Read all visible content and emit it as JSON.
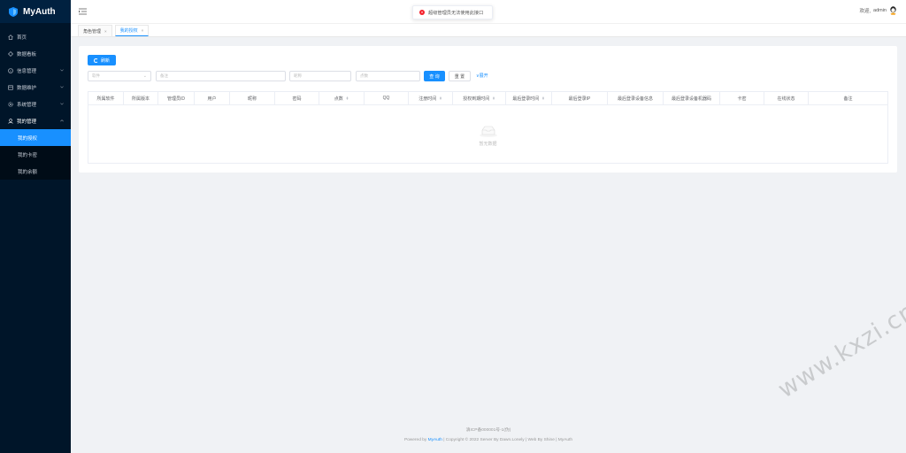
{
  "app": {
    "title": "MyAuth"
  },
  "sidebar": {
    "items": [
      {
        "label": "首页",
        "icon": "home-icon"
      },
      {
        "label": "数据看板",
        "icon": "dashboard-icon"
      },
      {
        "label": "信息管理",
        "icon": "info-icon"
      },
      {
        "label": "数据维护",
        "icon": "database-icon"
      },
      {
        "label": "系统管理",
        "icon": "gear-icon"
      },
      {
        "label": "我的管理",
        "icon": "user-icon"
      }
    ],
    "submenu": [
      {
        "label": "我的授权",
        "active": true
      },
      {
        "label": "我的卡密",
        "active": false
      },
      {
        "label": "我的余额",
        "active": false
      }
    ]
  },
  "header": {
    "welcome": "欢迎,",
    "user": "admin"
  },
  "toast": {
    "message": "超级管理员无法使用此接口"
  },
  "tabs": [
    {
      "label": "角色管理",
      "close": "×"
    },
    {
      "label": "我的授权",
      "close": "×"
    }
  ],
  "toolbar": {
    "refresh_label": "刷新"
  },
  "filters": {
    "software_placeholder": "软件",
    "remark_placeholder": "备注",
    "nickname_placeholder": "昵称",
    "points_placeholder": "点数",
    "search_label": "查 询",
    "reset_label": "重 置",
    "expand_label": "展开"
  },
  "table": {
    "columns": [
      "所属软件",
      "所属版本",
      "管理员ID",
      "用户",
      "昵称",
      "密码",
      "点数",
      "QQ",
      "注册时间",
      "授权到期时间",
      "最后登录时间",
      "最后登录IP",
      "最后登录设备信息",
      "最后登录设备机器码",
      "卡密",
      "在线状态",
      "备注"
    ],
    "empty_text": "暂无数据"
  },
  "footer": {
    "icp": "滇ICP备000001号-1(伪)",
    "powered_prefix": "Powered by ",
    "powered_brand": "MyAuth",
    "powered_suffix": " | Copyright © 2022 Server By Dawn.Lonely | Web By Shine | MyAuth"
  },
  "watermark": "www.kxzi.cn",
  "colors": {
    "primary": "#1890ff",
    "sidebar": "#001529",
    "danger": "#f5222d"
  }
}
